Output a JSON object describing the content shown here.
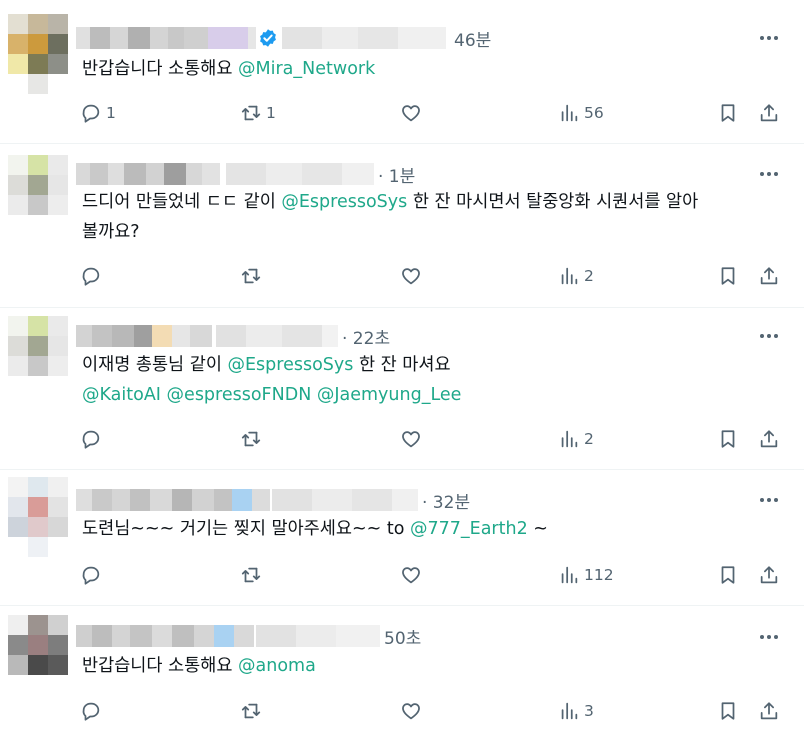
{
  "tweets": [
    {
      "time": "46분",
      "verified": true,
      "text_plain": "반갑습니다 소통해요 ",
      "mentions_line1": [
        "@Mira_Network"
      ],
      "text_after": "",
      "line2": "",
      "mentions_line2": [],
      "reply_count": "1",
      "retweet_count": "1",
      "like_count": "",
      "view_count": "56"
    },
    {
      "time": "· 1분",
      "verified": false,
      "text_plain": "드디어 만들었네 ㄷㄷ 같이 ",
      "mentions_line1": [
        "@EspressoSys"
      ],
      "text_after": " 한 잔 마시면서 탈중앙화 시퀀서를 알아",
      "line2": "볼까요?",
      "mentions_line2": [],
      "reply_count": "",
      "retweet_count": "",
      "like_count": "",
      "view_count": "2"
    },
    {
      "time": "· 22초",
      "verified": false,
      "text_plain": "이재명 총통님 같이 ",
      "mentions_line1": [
        "@EspressoSys"
      ],
      "text_after": " 한 잔 마셔요",
      "line2": "",
      "mentions_line2": [
        "@KaitoAI",
        "@espressoFNDN",
        "@Jaemyung_Lee"
      ],
      "reply_count": "",
      "retweet_count": "",
      "like_count": "",
      "view_count": "2"
    },
    {
      "time": "· 32분",
      "verified": false,
      "text_plain": "도련님~~~ 거기는 찢지 말아주세요~~ to ",
      "mentions_line1": [
        "@777_Earth2"
      ],
      "text_after": " ~",
      "line2": "",
      "mentions_line2": [],
      "reply_count": "",
      "retweet_count": "",
      "like_count": "",
      "view_count": "112"
    },
    {
      "time": "50초",
      "verified": false,
      "text_plain": "반갑습니다 소통해요 ",
      "mentions_line1": [
        "@anoma"
      ],
      "text_after": "",
      "line2": "",
      "mentions_line2": [],
      "reply_count": "",
      "retweet_count": "",
      "like_count": "",
      "view_count": "3"
    }
  ],
  "icons": {
    "reply": "reply-icon",
    "retweet": "retweet-icon",
    "like": "heart-icon",
    "views": "views-icon",
    "bookmark": "bookmark-icon",
    "share": "share-icon",
    "more": "more-icon",
    "verified": "verified-badge-icon"
  },
  "colors": {
    "mention": "#1fa88a",
    "verified": "#1d9bf0",
    "muted": "#536471",
    "divider": "#eff3f4"
  }
}
